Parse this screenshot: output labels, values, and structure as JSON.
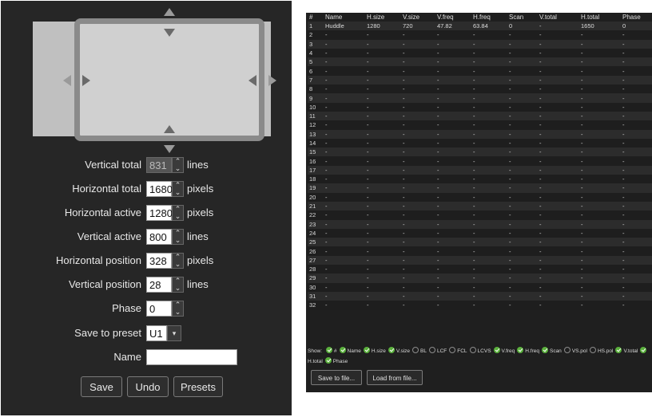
{
  "form": {
    "rows": [
      {
        "label": "Vertical total",
        "value": "831",
        "unit": "lines",
        "disabled": true
      },
      {
        "label": "Horizontal total",
        "value": "1680",
        "unit": "pixels",
        "disabled": false
      },
      {
        "label": "Horizontal active",
        "value": "1280",
        "unit": "pixels",
        "disabled": false
      },
      {
        "label": "Vertical active",
        "value": "800",
        "unit": "lines",
        "disabled": false
      },
      {
        "label": "Horizontal position",
        "value": "328",
        "unit": "pixels",
        "disabled": false
      },
      {
        "label": "Vertical position",
        "value": "28",
        "unit": "lines",
        "disabled": false
      },
      {
        "label": "Phase",
        "value": "0",
        "unit": "",
        "disabled": false
      }
    ],
    "save_preset_label": "Save to preset",
    "save_preset_value": "U1",
    "name_label": "Name",
    "name_value": "",
    "buttons": {
      "save": "Save",
      "undo": "Undo",
      "presets": "Presets"
    }
  },
  "table": {
    "headers": [
      "#",
      "Name",
      "H.size",
      "V.size",
      "V.freq",
      "H.freq",
      "Scan",
      "V.total",
      "H.total",
      "Phase"
    ],
    "first_row": [
      "1",
      "Huddle",
      "1280",
      "720",
      "47.82",
      "63.84",
      "0",
      "-",
      "1650",
      "0"
    ],
    "empty_cell": "-",
    "row_count": 32
  },
  "show": {
    "label": "Show:",
    "options": [
      {
        "name": "#",
        "on": true
      },
      {
        "name": "Name",
        "on": true
      },
      {
        "name": "H.size",
        "on": true
      },
      {
        "name": "V.size",
        "on": true
      },
      {
        "name": "BL",
        "on": false
      },
      {
        "name": "LCF",
        "on": false
      },
      {
        "name": "FCL",
        "on": false
      },
      {
        "name": "LCVS",
        "on": false
      },
      {
        "name": "V.freq",
        "on": true
      },
      {
        "name": "H.freq",
        "on": true
      },
      {
        "name": "Scan",
        "on": true
      },
      {
        "name": "VS.pol",
        "on": false
      },
      {
        "name": "HS.pol",
        "on": false
      },
      {
        "name": "V.total",
        "on": true
      },
      {
        "name": "H.total",
        "on": true
      },
      {
        "name": "Phase",
        "on": true
      }
    ]
  },
  "file_buttons": {
    "save": "Save to file...",
    "load": "Load from file..."
  }
}
